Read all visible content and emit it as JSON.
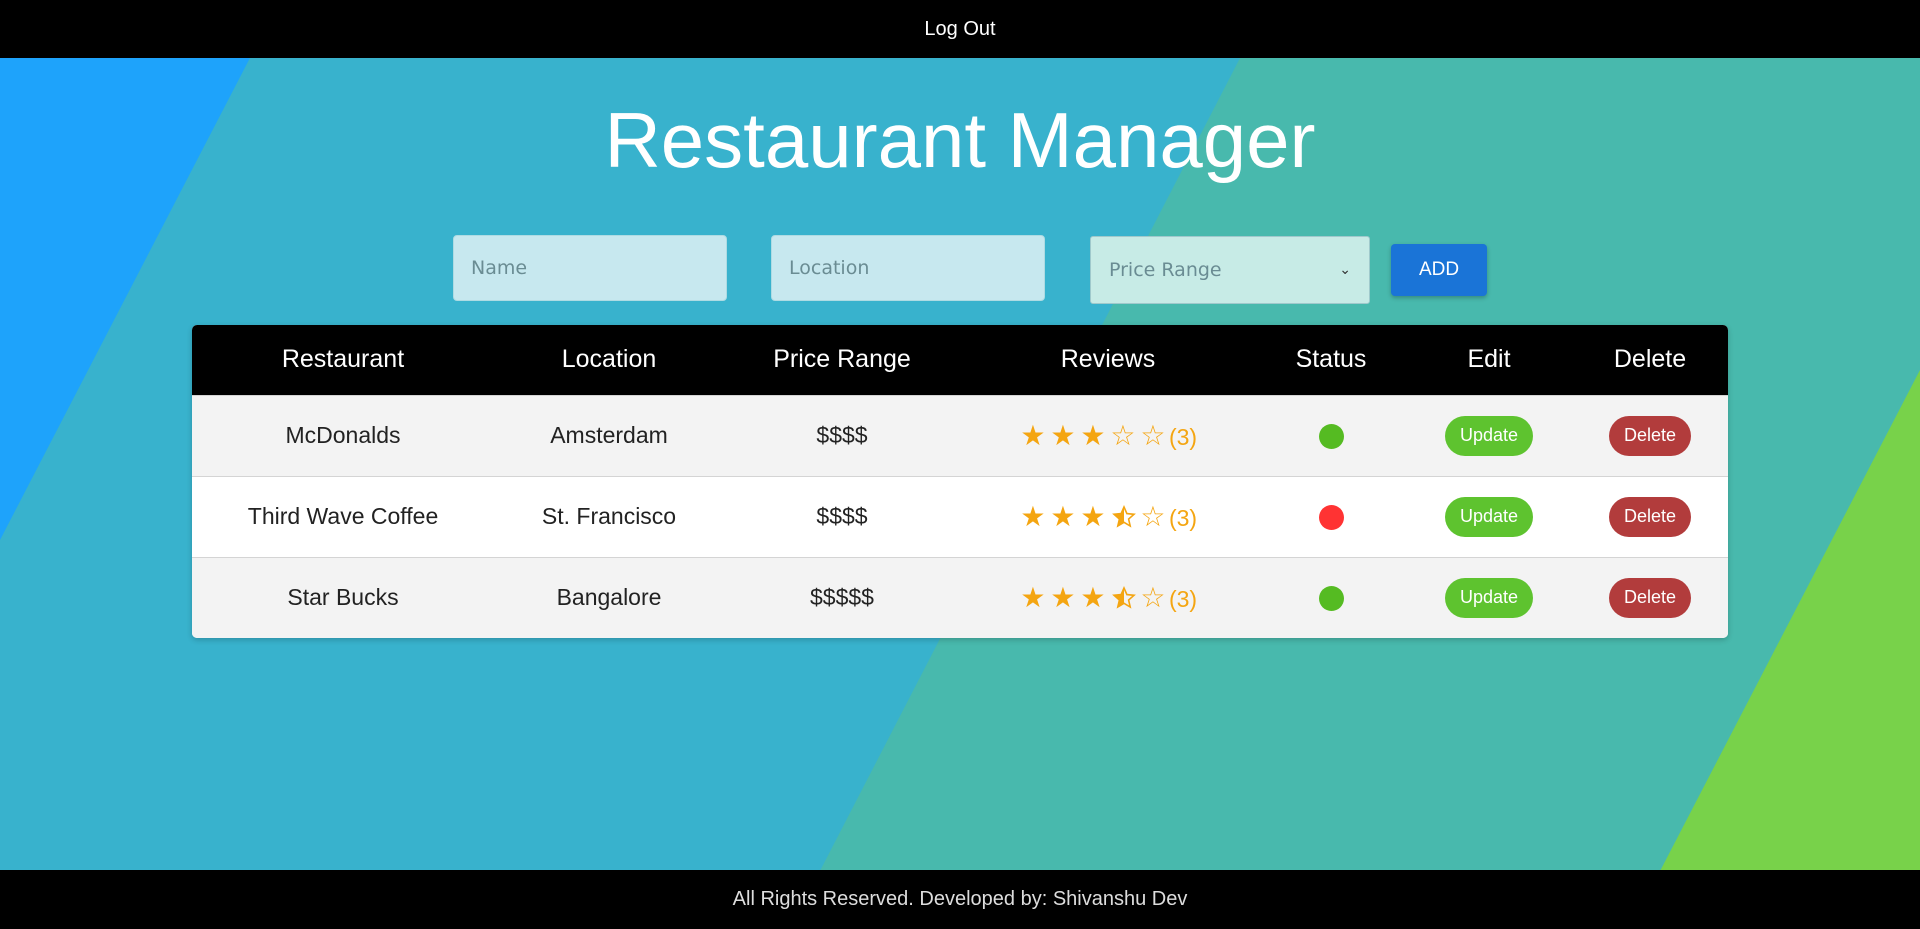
{
  "header": {
    "logout_label": "Log Out"
  },
  "page": {
    "title": "Restaurant Manager"
  },
  "form": {
    "name_placeholder": "Name",
    "location_placeholder": "Location",
    "price_range_selected": "Price Range",
    "add_label": "ADD"
  },
  "table": {
    "headers": [
      "Restaurant",
      "Location",
      "Price Range",
      "Reviews",
      "Status",
      "Edit",
      "Delete"
    ],
    "rows": [
      {
        "name": "McDonalds",
        "location": "Amsterdam",
        "price": "$$$$",
        "rating": 3,
        "review_count": "(3)",
        "status_color": "#55bb22",
        "update_label": "Update",
        "delete_label": "Delete"
      },
      {
        "name": "Third Wave Coffee",
        "location": "St. Francisco",
        "price": "$$$$",
        "rating": 3.5,
        "review_count": "(3)",
        "status_color": "#ff3333",
        "update_label": "Update",
        "delete_label": "Delete"
      },
      {
        "name": "Star Bucks",
        "location": "Bangalore",
        "price": "$$$$$",
        "rating": 3.5,
        "review_count": "(3)",
        "status_color": "#55bb22",
        "update_label": "Update",
        "delete_label": "Delete"
      }
    ]
  },
  "footer": {
    "text": "All Rights Reserved. Developed by: Shivanshu Dev"
  },
  "colors": {
    "accent": "#1a74d7",
    "update": "#5ec32f",
    "delete": "#b23c3c",
    "star": "#f4a511"
  }
}
